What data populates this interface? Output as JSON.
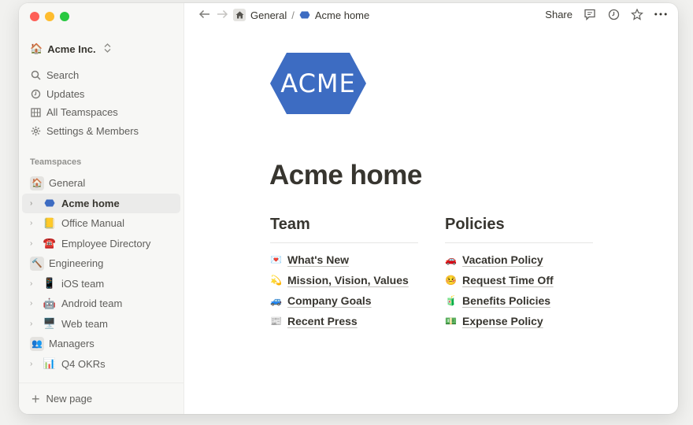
{
  "window": {
    "traffic_lights": [
      "close",
      "minimize",
      "zoom"
    ]
  },
  "sidebar": {
    "workspace": {
      "emoji": "🏠",
      "name": "Acme Inc.",
      "switcher_icon": "⌃"
    },
    "nav": [
      {
        "icon": "search-icon",
        "glyph": "⌕",
        "label": "Search"
      },
      {
        "icon": "clock-icon",
        "glyph": "◷",
        "label": "Updates"
      },
      {
        "icon": "teamspaces-icon",
        "glyph": "▦",
        "label": "All Teamspaces"
      },
      {
        "icon": "gear-icon",
        "glyph": "⚙",
        "label": "Settings & Members"
      }
    ],
    "section_label": "Teamspaces",
    "tree": [
      {
        "kind": "top",
        "emoji": "🏠",
        "label": "General"
      },
      {
        "kind": "sub",
        "emoji": "🔷",
        "label": "Acme home",
        "active": true
      },
      {
        "kind": "sub",
        "emoji": "📒",
        "label": "Office Manual"
      },
      {
        "kind": "sub",
        "emoji": "☎️",
        "label": "Employee Directory"
      },
      {
        "kind": "top",
        "emoji": "🔨",
        "label": "Engineering"
      },
      {
        "kind": "sub",
        "emoji": "📱",
        "label": "iOS team"
      },
      {
        "kind": "sub",
        "emoji": "🤖",
        "label": "Android team"
      },
      {
        "kind": "sub",
        "emoji": "🖥️",
        "label": "Web team"
      },
      {
        "kind": "top",
        "emoji": "👥",
        "label": "Managers"
      },
      {
        "kind": "sub",
        "emoji": "📊",
        "label": "Q4 OKRs"
      }
    ],
    "new_page_label": "New page"
  },
  "topbar": {
    "breadcrumb": {
      "parent": "General",
      "separator": "/",
      "current": "Acme home"
    },
    "share_label": "Share",
    "action_icons": [
      "comment-icon",
      "history-icon",
      "star-icon",
      "more-icon"
    ]
  },
  "page": {
    "logo_text": "ACME",
    "title": "Acme home",
    "columns": [
      {
        "heading": "Team",
        "links": [
          {
            "emoji": "💌",
            "label": "What's New"
          },
          {
            "emoji": "💫",
            "label": "Mission, Vision, Values"
          },
          {
            "emoji": "🚙",
            "label": "Company Goals"
          },
          {
            "emoji": "📰",
            "label": "Recent Press"
          }
        ]
      },
      {
        "heading": "Policies",
        "links": [
          {
            "emoji": "🚗",
            "label": "Vacation Policy"
          },
          {
            "emoji": "🤒",
            "label": "Request Time Off"
          },
          {
            "emoji": "🧃",
            "label": "Benefits Policies"
          },
          {
            "emoji": "💵",
            "label": "Expense Policy"
          }
        ]
      }
    ]
  },
  "colors": {
    "accent_blue": "#3d6cc2",
    "text": "#37352f",
    "sidebar_bg": "#f7f7f5"
  }
}
